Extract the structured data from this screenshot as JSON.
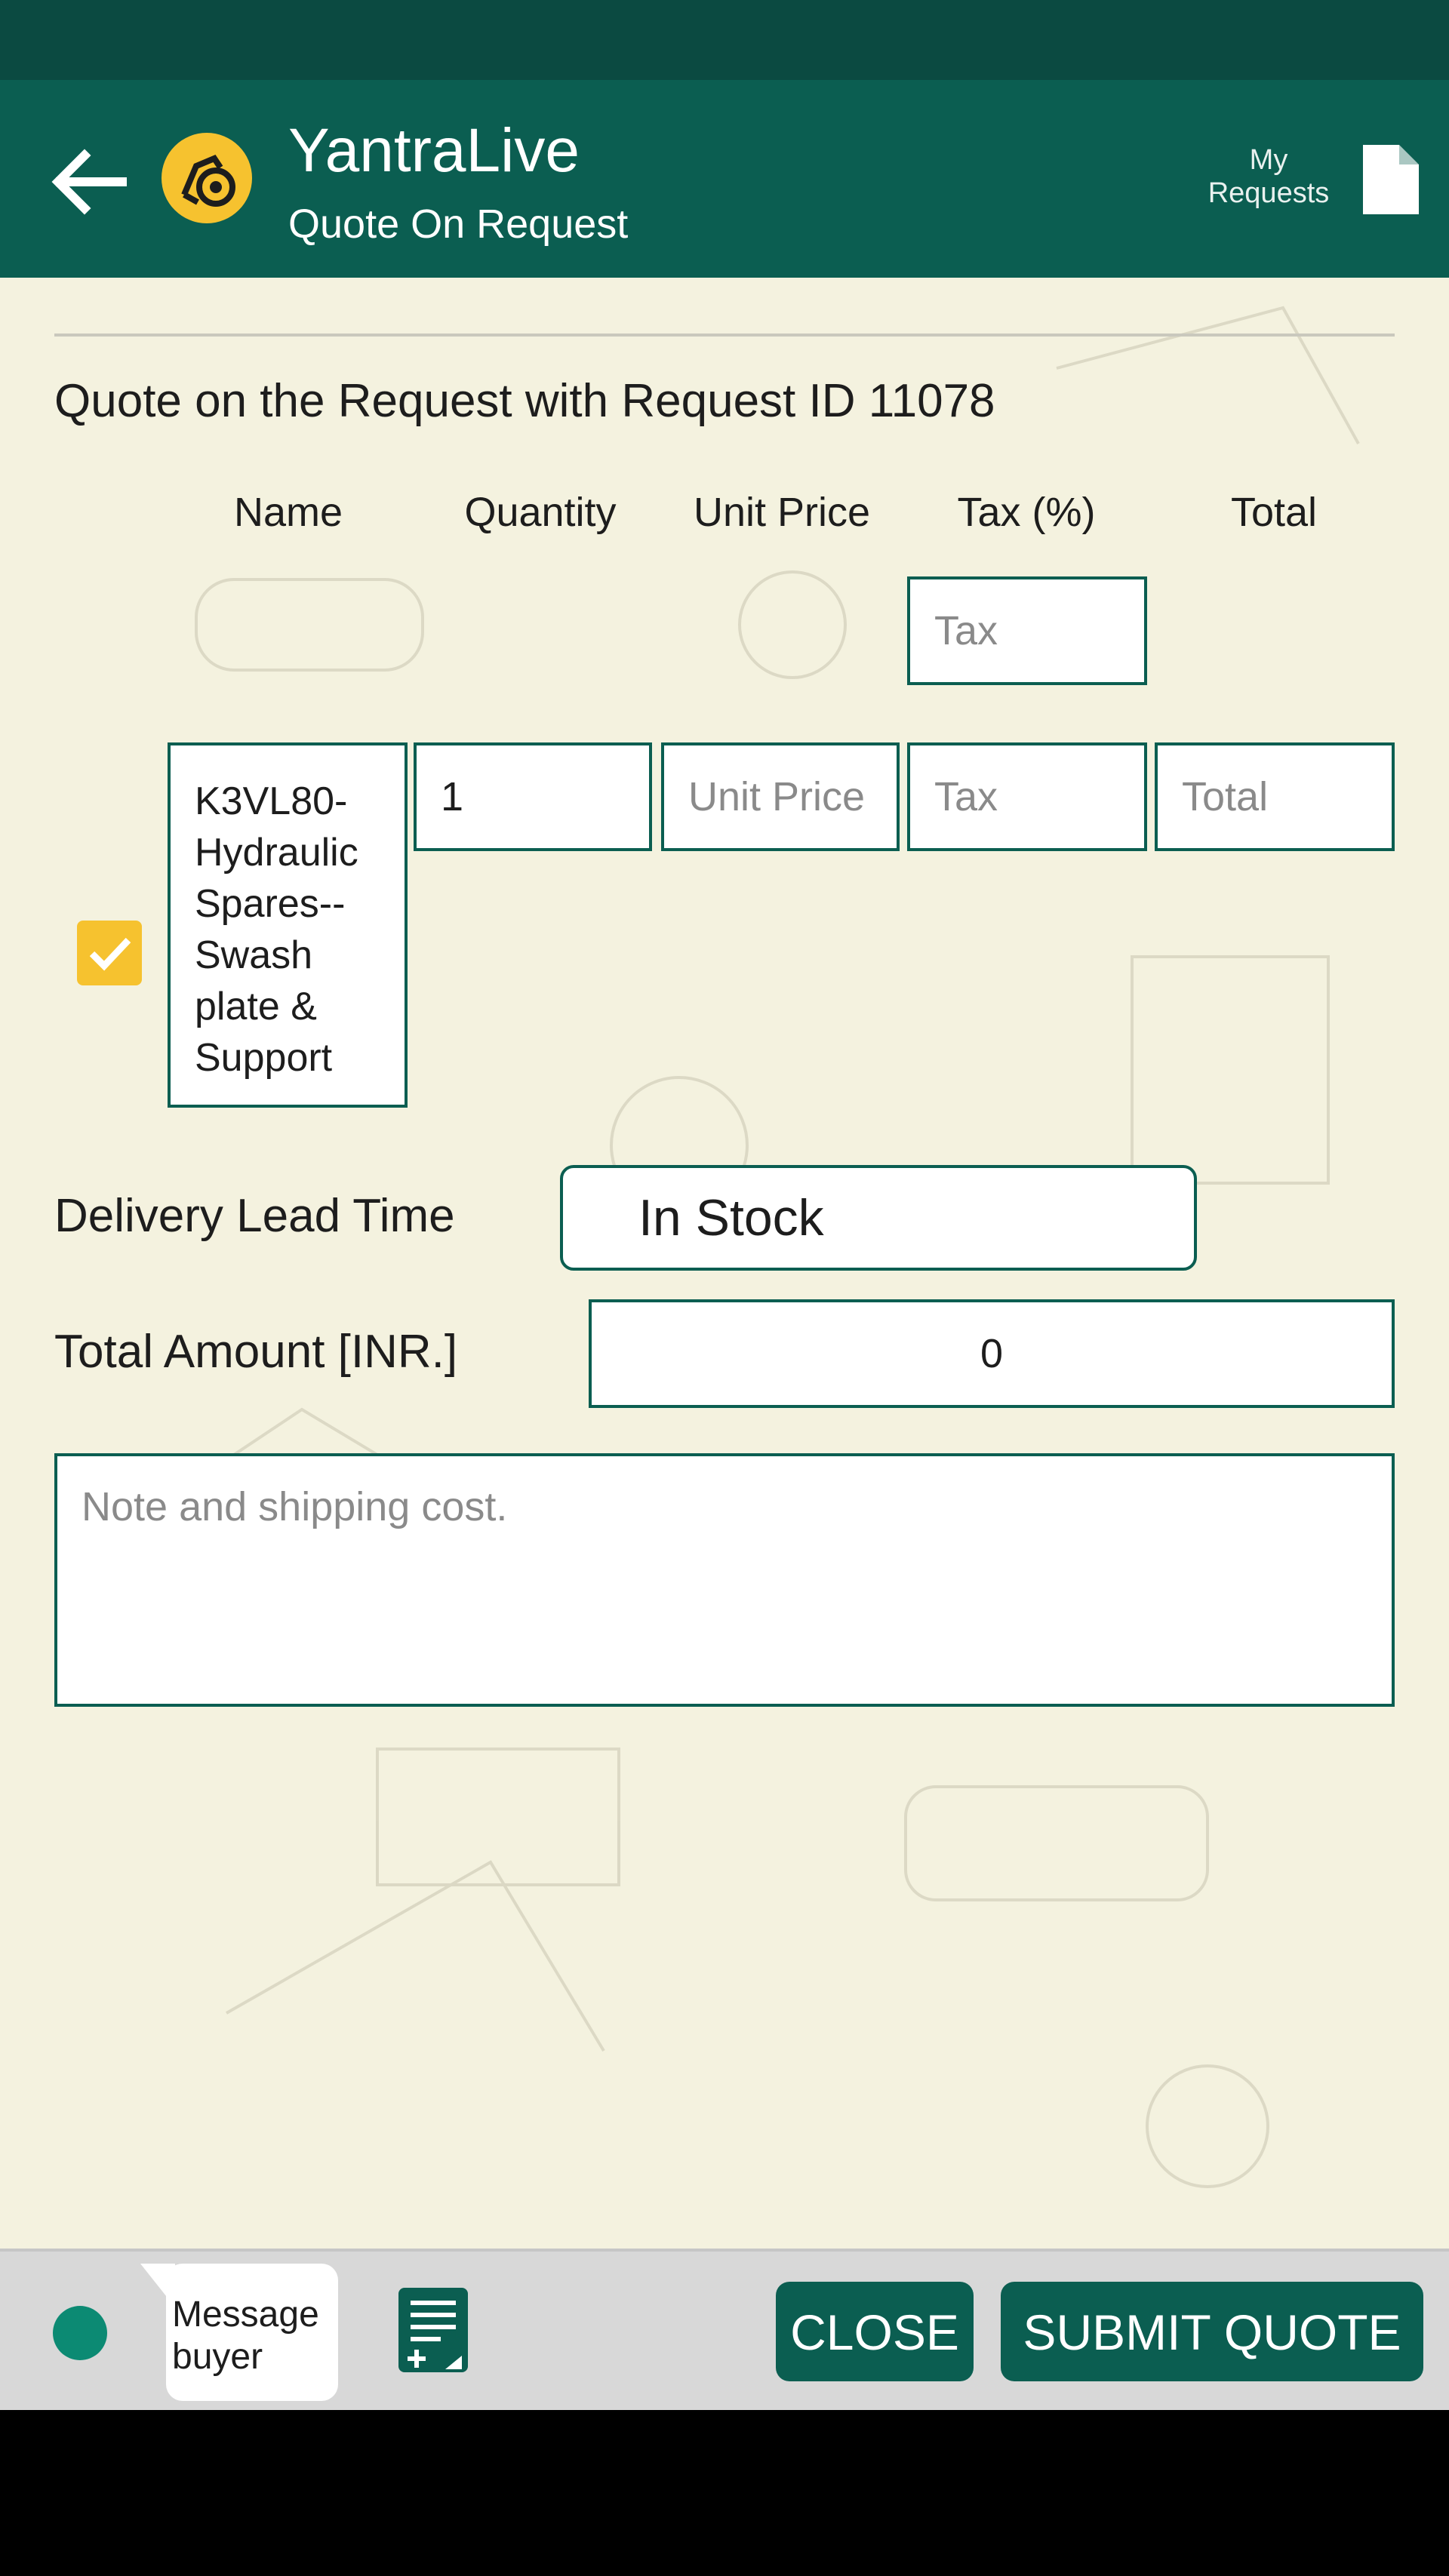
{
  "header": {
    "app_title": "YantraLive",
    "subtitle": "Quote On Request",
    "my_requests_label": "My\nRequests",
    "bg_color": "#0b5e51",
    "logo_color": "#f6c22f"
  },
  "main": {
    "heading": "Quote on the Request with Request ID 11078",
    "columns": [
      "Name",
      "Quantity",
      "Unit Price",
      "Tax (%)",
      "Total"
    ],
    "global_tax_placeholder": "Tax",
    "row": {
      "checked": true,
      "name": "K3VL80-\nHydraulic\nSpares--\nSwash\nplate &\nSupport",
      "quantity": "1",
      "unit_price_placeholder": "Unit Price",
      "tax_placeholder": "Tax",
      "total_placeholder": "Total"
    },
    "delivery_label": "Delivery Lead Time",
    "delivery_value": "In Stock",
    "total_label": "Total Amount [INR.]",
    "total_value": "0",
    "note_placeholder": "Note and shipping cost."
  },
  "footer": {
    "message_label": "Message\nbuyer",
    "close_label": "CLOSE",
    "submit_label": "SUBMIT QUOTE"
  }
}
